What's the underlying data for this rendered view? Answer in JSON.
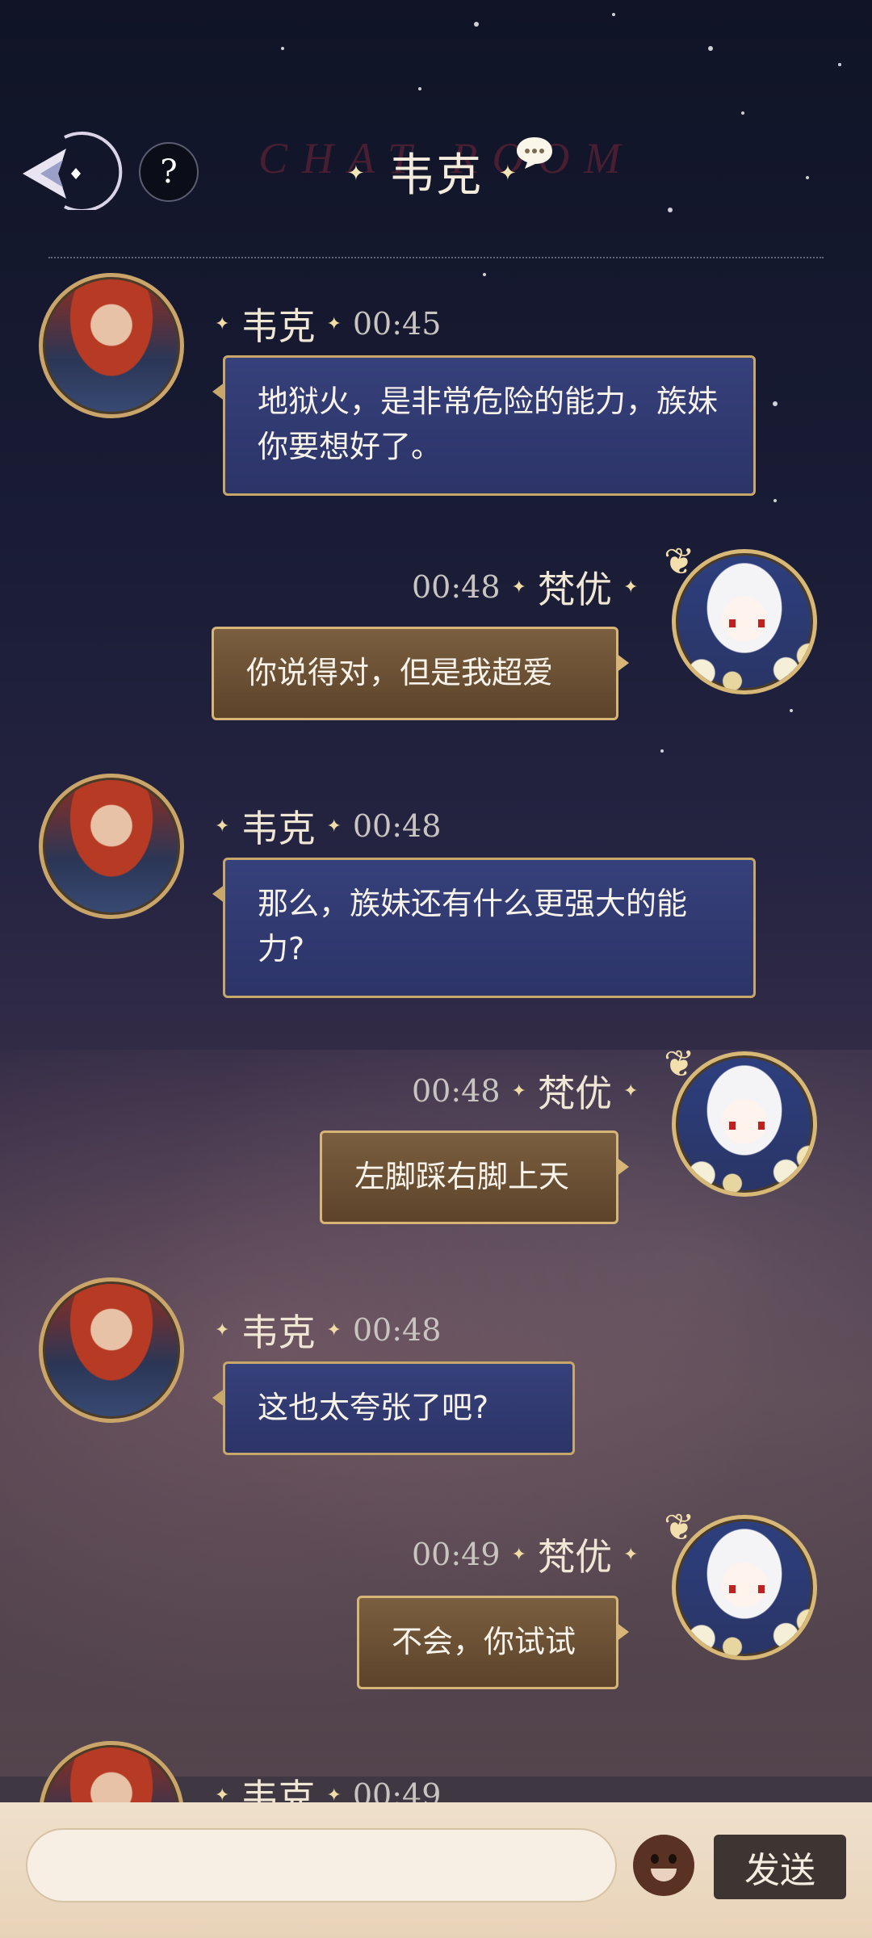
{
  "header": {
    "title": "韦克",
    "deco_text": "CHAT ROOM",
    "help_label": "?"
  },
  "input": {
    "placeholder": "",
    "send_label": "发送"
  },
  "messages": [
    {
      "sender": "韦克",
      "time": "00:45",
      "text": "地狱火，是非常危险的能力，族妹你要想好了。",
      "side": "left"
    },
    {
      "sender": "梵优",
      "time": "00:48",
      "text": "你说得对，但是我超爱",
      "side": "right"
    },
    {
      "sender": "韦克",
      "time": "00:48",
      "text": "那么，族妹还有什么更强大的能力?",
      "side": "left"
    },
    {
      "sender": "梵优",
      "time": "00:48",
      "text": "左脚踩右脚上天",
      "side": "right"
    },
    {
      "sender": "韦克",
      "time": "00:48",
      "text": "这也太夸张了吧?",
      "side": "left"
    },
    {
      "sender": "梵优",
      "time": "00:49",
      "text": "不会，你试试",
      "side": "right"
    },
    {
      "sender": "韦克",
      "time": "00:49",
      "text": "",
      "side": "left"
    }
  ]
}
